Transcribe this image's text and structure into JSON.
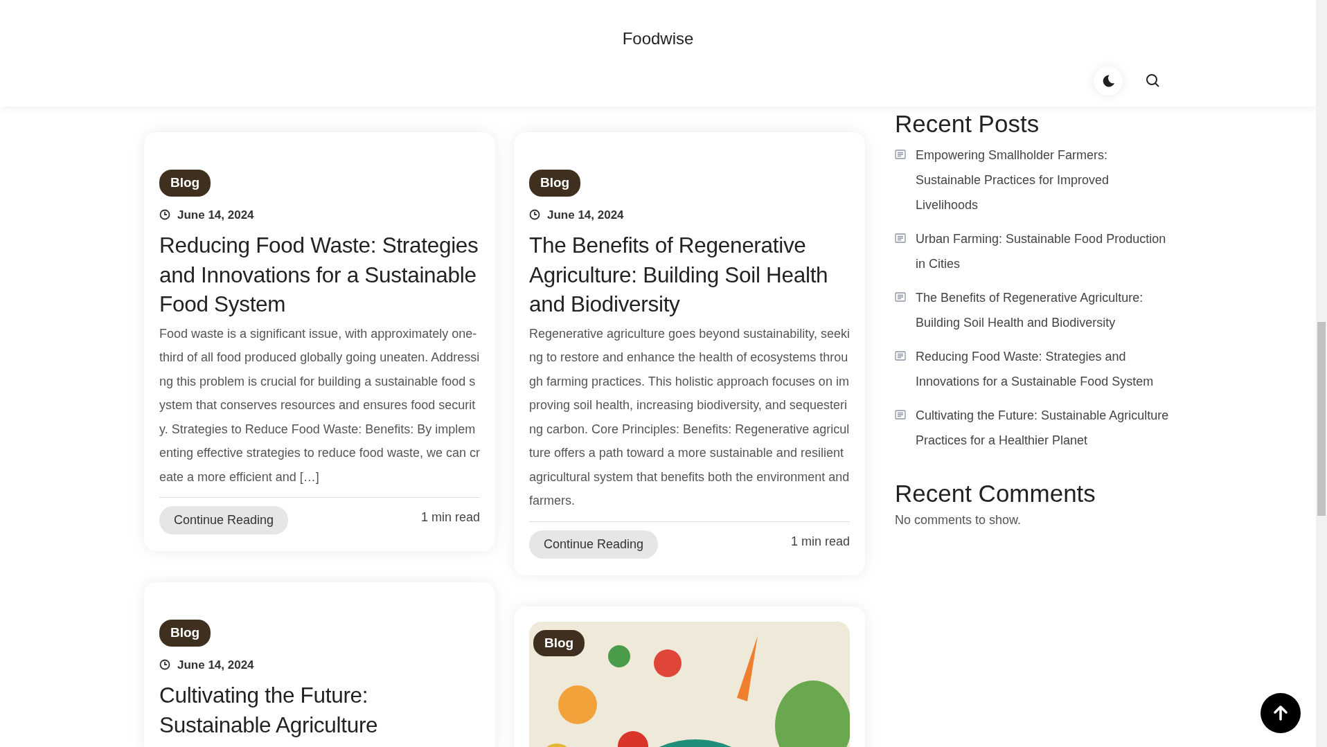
{
  "header": {
    "site_title": "Foodwise"
  },
  "columns": [
    [
      {
        "kind": "text",
        "category": "Blog",
        "date": "June 14, 2024",
        "title": "Reducing Food Waste: Strategies and Innovations for a Sustainable Food System",
        "excerpt": "Food waste is a significant issue, with approximately one-third of all food produced globally going uneaten. Addressing this problem is crucial for building a sustainable food system that conserves resources and ensures food security. Strategies to Reduce Food Waste: Benefits: By implementing effective strategies to reduce food waste, we can create a more efficient and […]",
        "button": "Continue Reading",
        "read_time": "1 min read"
      },
      {
        "kind": "text",
        "category": "Blog",
        "date": "June 14, 2024",
        "title": "Cultivating the Future: Sustainable Agriculture"
      }
    ],
    [
      {
        "kind": "text",
        "category": "Blog",
        "date": "June 14, 2024",
        "title": "The Benefits of Regenerative Agriculture: Building Soil Health and Biodiversity",
        "excerpt": "Regenerative agriculture goes beyond sustainability, seeking to restore and enhance the health of ecosystems through farming practices. This holistic approach focuses on improving soil health, increasing biodiversity, and sequestering carbon. Core Principles: Benefits: Regenerative agriculture offers a path toward a more sustainable and resilient agricultural system that benefits both the environment and farmers.",
        "button": "Continue Reading",
        "read_time": "1 min read"
      },
      {
        "kind": "image",
        "category": "Blog"
      }
    ]
  ],
  "recent_posts": {
    "title": "Recent Posts",
    "items": [
      "Empowering Smallholder Farmers: Sustainable Practices for Improved Livelihoods",
      "Urban Farming: Sustainable Food Production in Cities",
      "The Benefits of Regenerative Agriculture: Building Soil Health and Biodiversity",
      "Reducing Food Waste: Strategies and Innovations for a Sustainable Food System",
      "Cultivating the Future: Sustainable Agriculture Practices for a Healthier Planet"
    ]
  },
  "recent_comments": {
    "title": "Recent Comments",
    "text": "No comments to show."
  }
}
